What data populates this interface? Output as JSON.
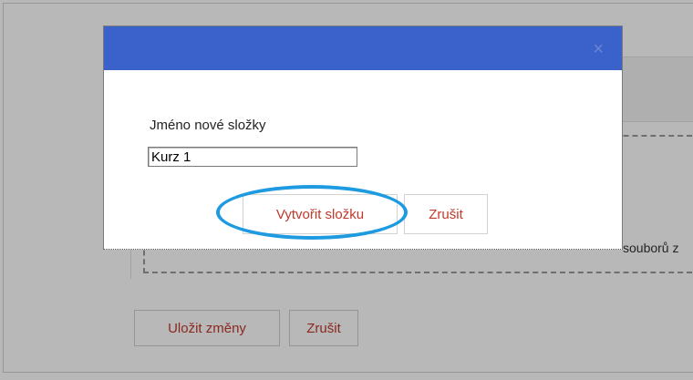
{
  "background": {
    "dropzone_text": "souborů z",
    "save_label": "Uložit změny",
    "cancel_label": "Zrušit"
  },
  "dialog": {
    "close_icon": "×",
    "folder_name_label": "Jméno nové složky",
    "folder_name_value": "Kurz 1",
    "create_label": "Vytvořit složku",
    "cancel_label": "Zrušit"
  },
  "colors": {
    "header": "#3b62cb",
    "button_text": "#c0392b",
    "highlight": "#1e9be0"
  }
}
